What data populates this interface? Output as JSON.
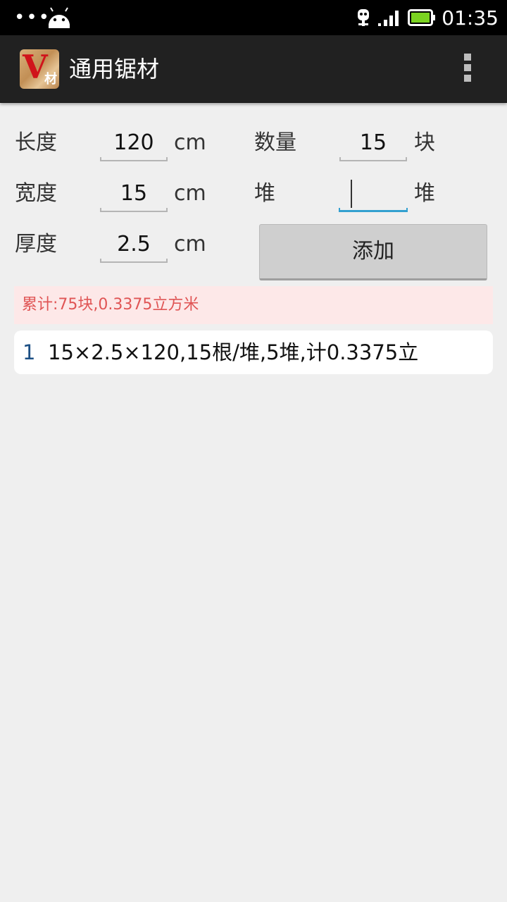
{
  "status_bar": {
    "dots": "•••",
    "time": "01:35",
    "icons": [
      "android-icon",
      "usb-debug-icon",
      "signal-icon",
      "battery-icon"
    ]
  },
  "action_bar": {
    "logo_letter": "V",
    "logo_sub": "材",
    "title": "通用锯材"
  },
  "form": {
    "length": {
      "label": "长度",
      "value": "120",
      "unit": "cm"
    },
    "width": {
      "label": "宽度",
      "value": "15",
      "unit": "cm"
    },
    "thickness": {
      "label": "厚度",
      "value": "2.5",
      "unit": "cm"
    },
    "quantity": {
      "label": "数量",
      "value": "15",
      "unit": "块"
    },
    "piles": {
      "label": "堆",
      "value": "",
      "unit": "堆"
    }
  },
  "add_label": "添加",
  "summary": "累计:75块,0.3375立方米",
  "items": [
    {
      "index": "1",
      "text": "15×2.5×120,15根/堆,5堆,计0.3375立"
    }
  ],
  "colors": {
    "accent": "#33a0d0",
    "summary_text": "#e05555",
    "summary_bg": "#fde8e8"
  }
}
